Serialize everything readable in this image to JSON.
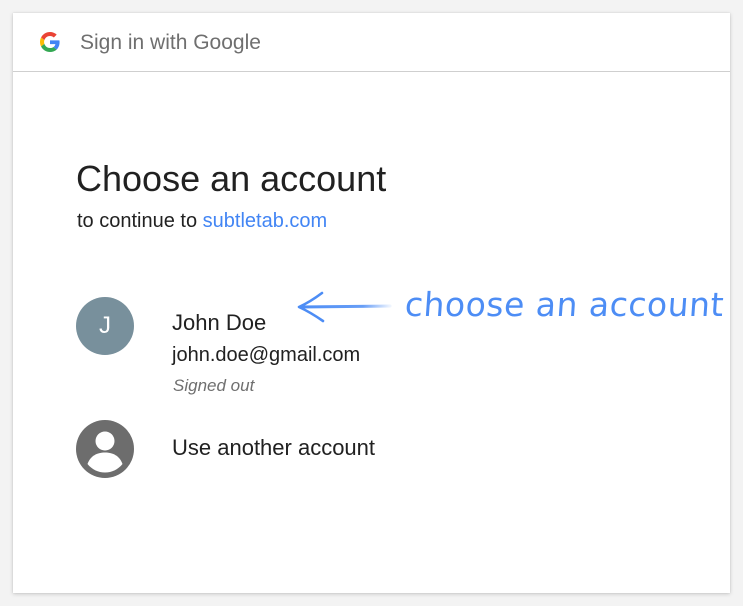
{
  "header": {
    "title": "Sign in with Google",
    "logo_icon": "google-g-icon"
  },
  "main": {
    "title": "Choose an account",
    "subtitle_prefix": "to continue to ",
    "subtitle_link": "subtletab.com"
  },
  "accounts": [
    {
      "avatar_letter": "J",
      "name": "John Doe",
      "email": "john.doe@gmail.com",
      "status": "Signed out",
      "avatar_color": "#78909c"
    }
  ],
  "another_account": {
    "label": "Use another account",
    "icon": "account-circle-icon"
  },
  "annotation": {
    "text": "choose an account",
    "color": "#4d8df5"
  },
  "colors": {
    "link": "#4285f4",
    "google_blue": "#4285F4",
    "google_red": "#EA4335",
    "google_yellow": "#FBBC05",
    "google_green": "#34A853"
  }
}
